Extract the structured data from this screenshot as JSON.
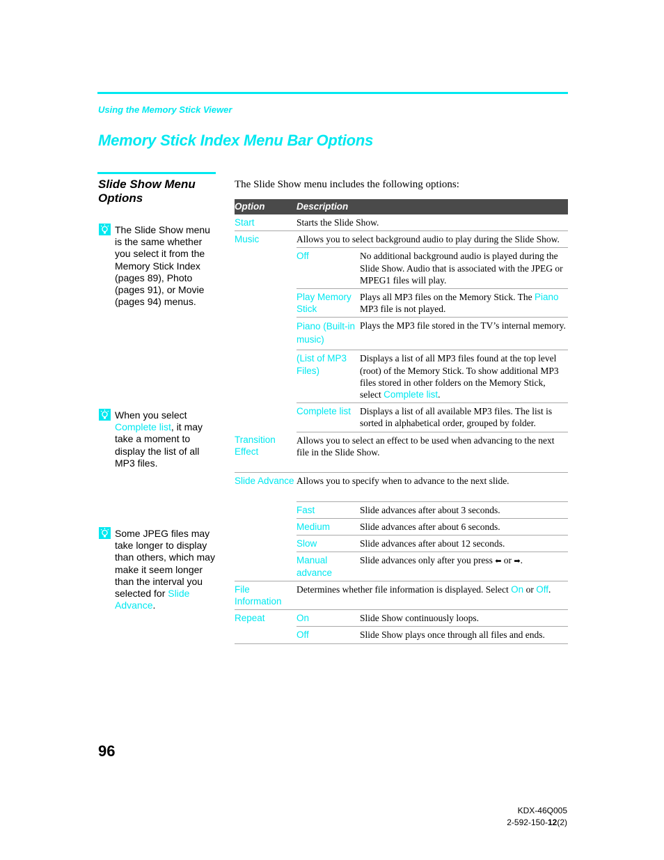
{
  "header": {
    "running_head": "Using the Memory Stick Viewer",
    "page_title": "Memory Stick Index Menu Bar Options"
  },
  "sidebar": {
    "section_title": "Slide Show Menu Options",
    "tips": [
      {
        "icon": "lightbulb-icon",
        "text": "The Slide Show menu is the same whether you select it from the Memory Stick Index (pages 89), Photo (pages 91), or Movie (pages 94) menus."
      },
      {
        "icon": "lightbulb-icon",
        "before": "When you select ",
        "link": "Complete list",
        "after": ", it may take a moment to display the list of all MP3 files."
      },
      {
        "icon": "lightbulb-icon",
        "before": "Some JPEG files may take longer to display than others, which may make it seem longer than the interval you selected for ",
        "link": "Slide Advance",
        "after": "."
      }
    ]
  },
  "main": {
    "intro": "The Slide Show menu includes the following options:",
    "table": {
      "headers": [
        "Option",
        "Description"
      ],
      "rows": {
        "start": {
          "option": "Start",
          "description": "Starts the Slide Show."
        },
        "music": {
          "option": "Music",
          "description": "Allows you to select background audio to play during the Slide Show.",
          "sub": {
            "off": {
              "option": "Off",
              "description": "No additional background audio is played during the Slide Show. Audio that is associated with the JPEG or MPEG1 files will play."
            },
            "play_memory_stick": {
              "option": "Play Memory Stick",
              "desc_before": "Plays all MP3 files on the Memory Stick. The ",
              "desc_link": "Piano",
              "desc_after": " MP3 file is not played."
            },
            "piano": {
              "option": "Piano (Built-in music)",
              "description": "Plays the MP3 file stored in the TV’s internal memory."
            },
            "list_of_mp3": {
              "option": "(List of MP3 Files)",
              "desc_before": "Displays a list of all MP3 files found at the top level (root) of the Memory Stick. To show additional MP3 files stored in other folders on the Memory Stick, select ",
              "desc_link": "Complete list",
              "desc_after": "."
            },
            "complete_list": {
              "option": "Complete list",
              "description": "Displays a list of all available MP3 files. The list is sorted in alphabetical order, grouped by folder."
            }
          }
        },
        "transition": {
          "option": "Transition Effect",
          "description": "Allows you to select an effect to be used when advancing to the next file in the Slide Show."
        },
        "slide_advance": {
          "option": "Slide Advance",
          "description": "Allows you to specify when to advance to the next slide.",
          "sub": {
            "fast": {
              "option": "Fast",
              "description": "Slide advances after about 3 seconds."
            },
            "medium": {
              "option": "Medium",
              "description": "Slide advances after about 6 seconds."
            },
            "slow": {
              "option": "Slow",
              "description": "Slide advances after about 12 seconds."
            },
            "manual": {
              "option": "Manual advance",
              "desc_before": "Slide advances only after you press ",
              "arrow_left": "◆",
              "desc_mid": " or ",
              "arrow_right": "◆",
              "desc_after": "."
            }
          }
        },
        "file_info": {
          "option": "File Information",
          "desc_before": "Determines whether file information is displayed. Select ",
          "link_on": "On",
          "desc_mid": " or ",
          "link_off": "Off",
          "desc_after": "."
        },
        "repeat": {
          "option": "Repeat",
          "sub": {
            "on": {
              "option": "On",
              "description": "Slide Show continuously loops."
            },
            "off": {
              "option": "Off",
              "description": "Slide Show plays once through all files and ends."
            }
          }
        }
      }
    }
  },
  "footer": {
    "page_number": "96",
    "model": "KDX-46Q005",
    "part_prefix": "2-592-150-",
    "part_bold": "12",
    "part_suffix": "(2)"
  },
  "colors": {
    "accent": "#00e8f0",
    "table_header_bg": "#4a4a4a",
    "rule": "#a8a8a8"
  }
}
